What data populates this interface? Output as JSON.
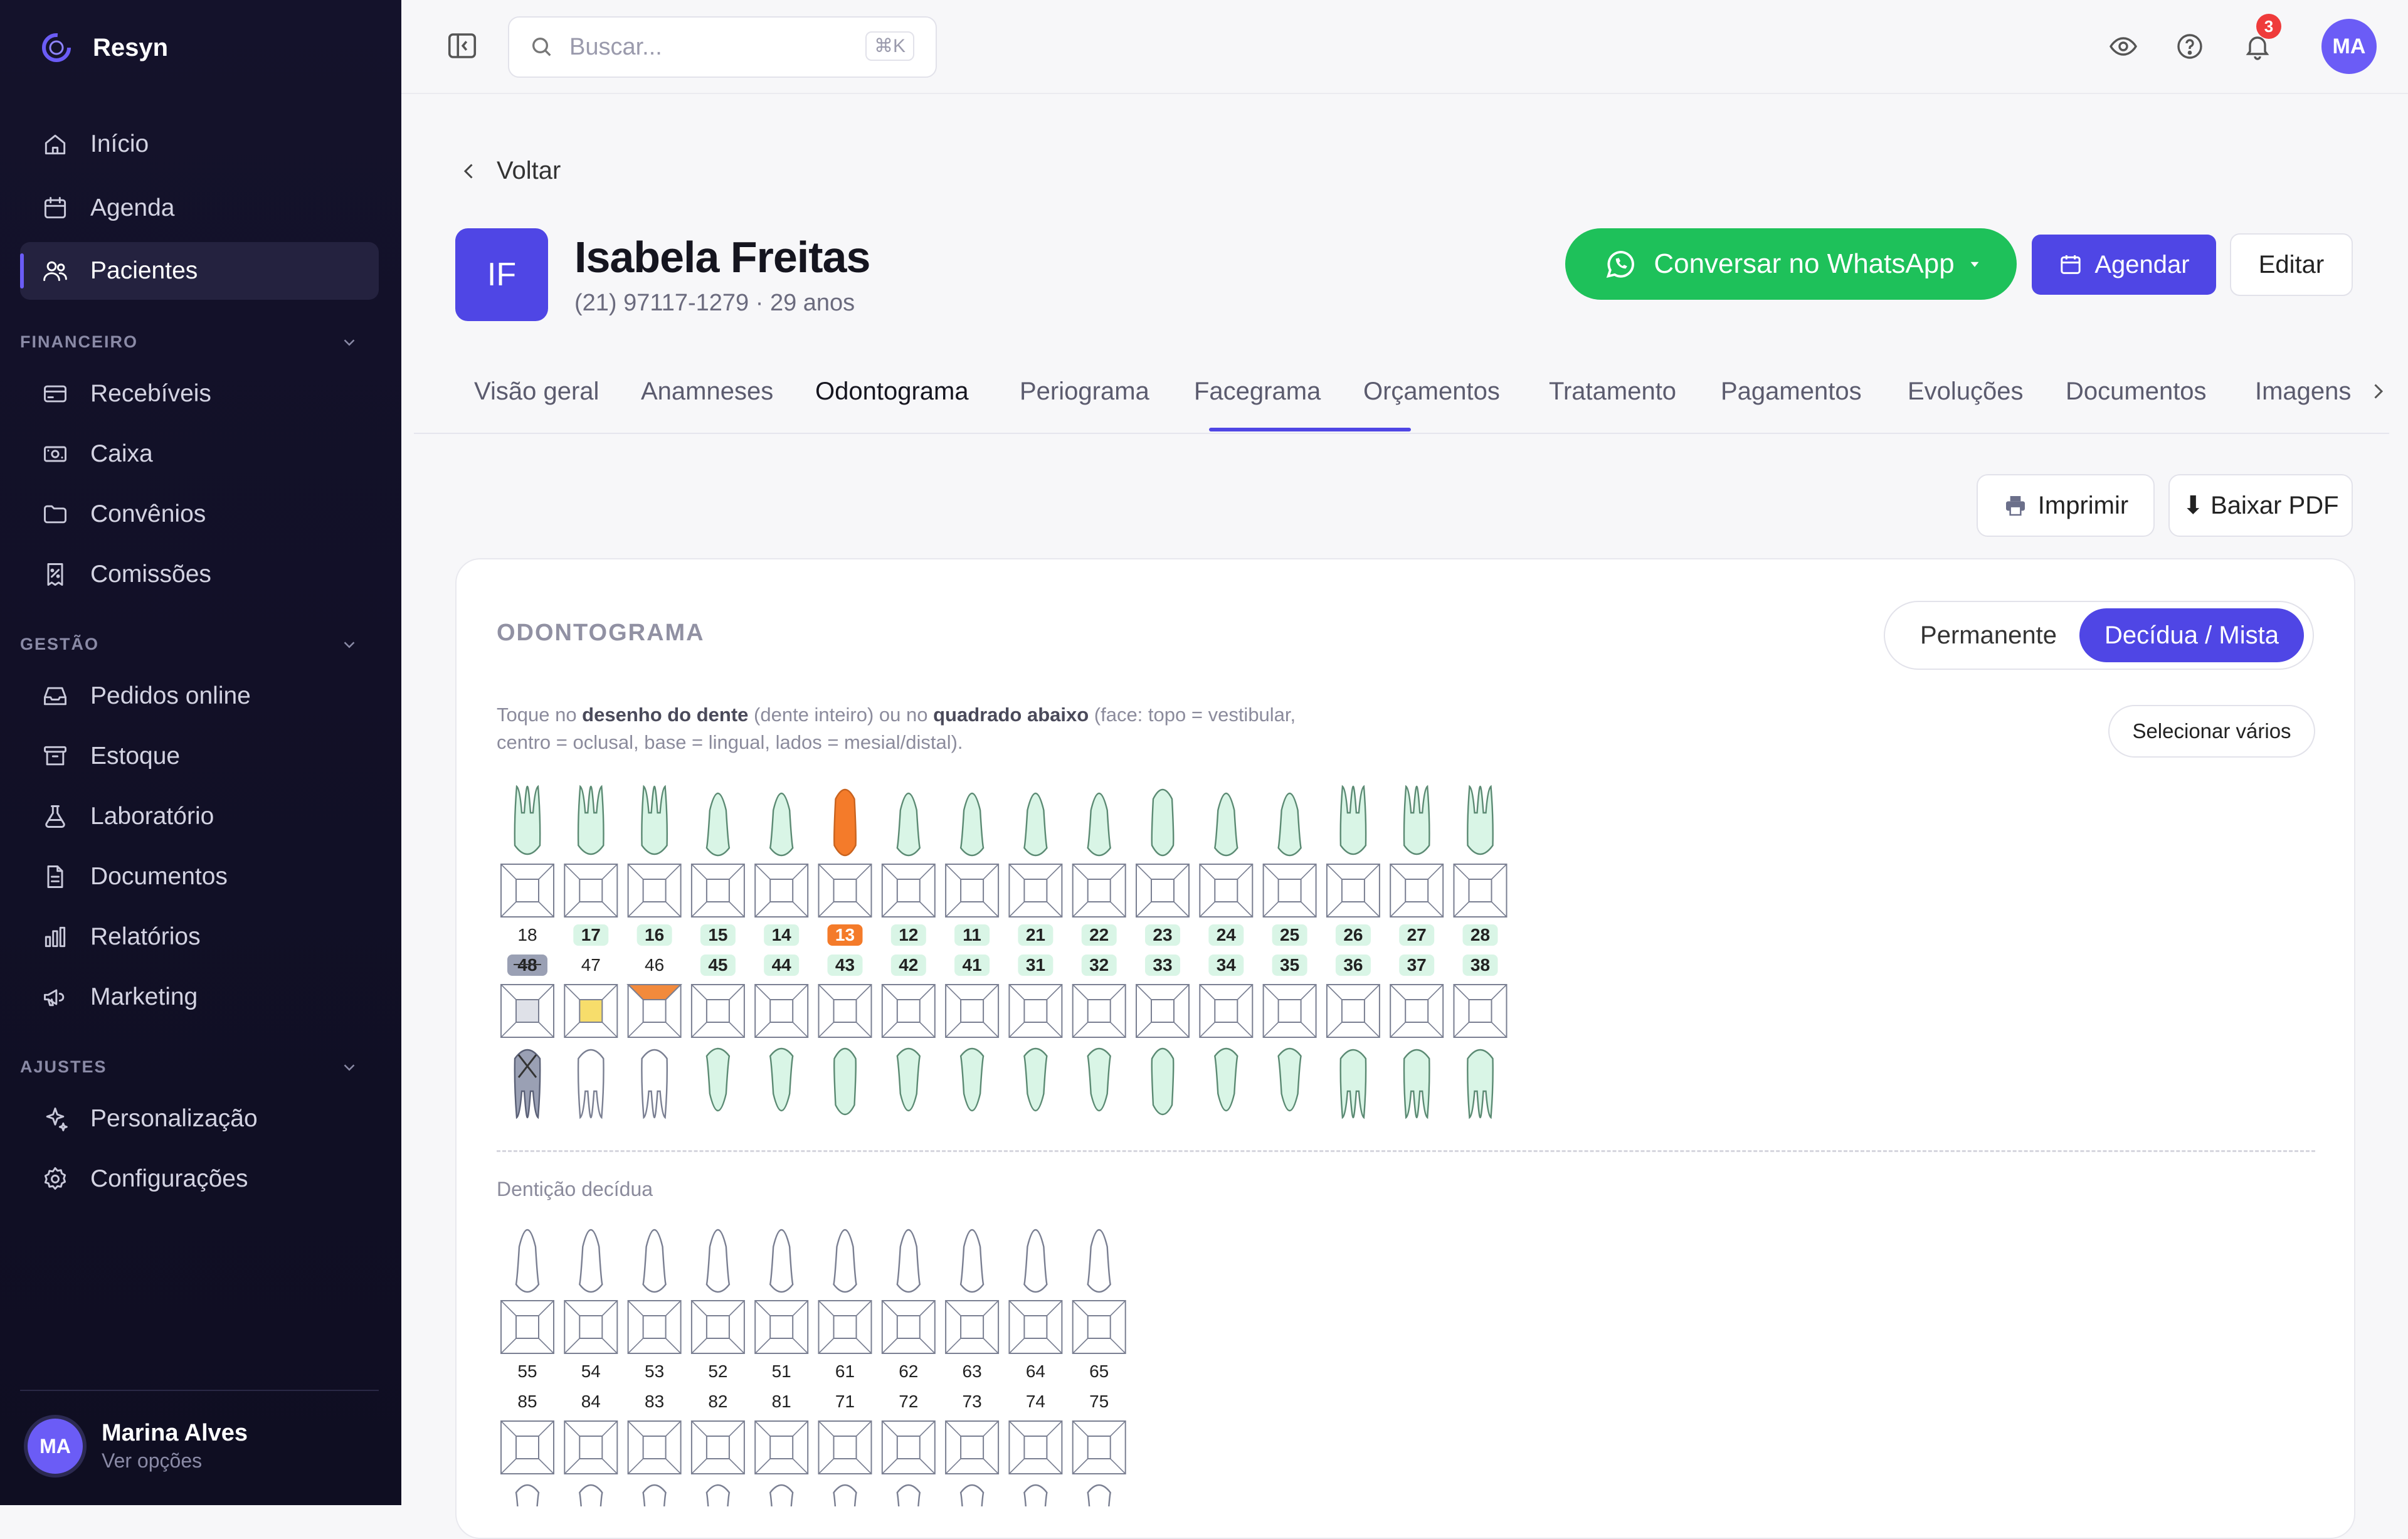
{
  "app": {
    "brand": "Resyn"
  },
  "sidebar": {
    "items_top": [
      {
        "label": "Início",
        "icon": "home-icon"
      },
      {
        "label": "Agenda",
        "icon": "calendar-icon"
      },
      {
        "label": "Pacientes",
        "icon": "users-icon",
        "active": true
      }
    ],
    "sections": [
      {
        "title": "FINANCEIRO",
        "items": [
          {
            "label": "Recebíveis",
            "icon": "card-icon"
          },
          {
            "label": "Caixa",
            "icon": "cash-icon"
          },
          {
            "label": "Convênios",
            "icon": "folder-icon"
          },
          {
            "label": "Comissões",
            "icon": "receipt-icon"
          }
        ]
      },
      {
        "title": "GESTÃO",
        "items": [
          {
            "label": "Pedidos online",
            "icon": "inbox-icon"
          },
          {
            "label": "Estoque",
            "icon": "archive-icon"
          },
          {
            "label": "Laboratório",
            "icon": "flask-icon"
          },
          {
            "label": "Documentos",
            "icon": "document-icon"
          },
          {
            "label": "Relatórios",
            "icon": "bar-chart-icon"
          },
          {
            "label": "Marketing",
            "icon": "megaphone-icon"
          }
        ]
      },
      {
        "title": "AJUSTES",
        "items": [
          {
            "label": "Personalização",
            "icon": "sparkles-icon"
          },
          {
            "label": "Configurações",
            "icon": "gear-icon"
          }
        ]
      }
    ],
    "user": {
      "initials": "MA",
      "name": "Marina Alves",
      "sub": "Ver opções"
    }
  },
  "topbar": {
    "search_placeholder": "Buscar...",
    "shortcut": "⌘K",
    "notifications": "3",
    "avatar": "MA"
  },
  "patient": {
    "back_label": "Voltar",
    "initials": "IF",
    "name": "Isabela Freitas",
    "subtitle": "(21) 97117-1279 · 29 anos",
    "whatsapp_label": "Conversar no WhatsApp",
    "schedule_label": "Agendar",
    "edit_label": "Editar"
  },
  "tabs": [
    "Visão geral",
    "Anamneses",
    "Odontograma",
    "Periograma",
    "Facegrama",
    "Orçamentos",
    "Tratamento",
    "Pagamentos",
    "Evoluções",
    "Documentos",
    "Imagens"
  ],
  "active_tab": "Odontograma",
  "actions": {
    "print_label": "Imprimir",
    "pdf_label": "⬇ Baixar PDF"
  },
  "odontogram": {
    "title": "ODONTOGRAMA",
    "mode_options": [
      "Permanente",
      "Decídua / Mista"
    ],
    "mode_selected": "Decídua / Mista",
    "hint": {
      "p1": "Toque no ",
      "b1": "desenho do dente",
      "p2": " (dente inteiro) ou no ",
      "b2": "quadrado abaixo",
      "p3": " (face: topo = vestibular, centro = oclusal, base = lingual, lados = mesial/distal)."
    },
    "select_multiple_label": "Selecionar vários",
    "colors": {
      "healthy": "#d9f5e6",
      "healthy_stroke": "#5b8a73",
      "treated": "#f47b2a",
      "missing": "#9aa0b4",
      "caries": "#f7dd6b",
      "restoration": "#f28a3c",
      "outline": "#7a7f92"
    },
    "permanent_upper": [
      "18",
      "17",
      "16",
      "15",
      "14",
      "13",
      "12",
      "11",
      "21",
      "22",
      "23",
      "24",
      "25",
      "26",
      "27",
      "28"
    ],
    "permanent_lower": [
      "48",
      "47",
      "46",
      "45",
      "44",
      "43",
      "42",
      "41",
      "31",
      "32",
      "33",
      "34",
      "35",
      "36",
      "37",
      "38"
    ],
    "upper_status": {
      "13": "treated"
    },
    "lower_status": {
      "48": "missing",
      "47": "caries-center",
      "46": "restoration-top"
    },
    "healthy_labels_upper": [
      "17",
      "16",
      "15",
      "14",
      "12",
      "11",
      "21",
      "22",
      "23",
      "24",
      "25",
      "26",
      "27",
      "28"
    ],
    "healthy_labels_lower": [
      "45",
      "44",
      "43",
      "42",
      "41",
      "31",
      "32",
      "33",
      "34",
      "35",
      "36",
      "37",
      "38"
    ],
    "deciduous_label": "Dentição decídua",
    "deciduous_upper": [
      "55",
      "54",
      "53",
      "52",
      "51",
      "61",
      "62",
      "63",
      "64",
      "65"
    ],
    "deciduous_lower": [
      "85",
      "84",
      "83",
      "82",
      "81",
      "71",
      "72",
      "73",
      "74",
      "75"
    ]
  }
}
